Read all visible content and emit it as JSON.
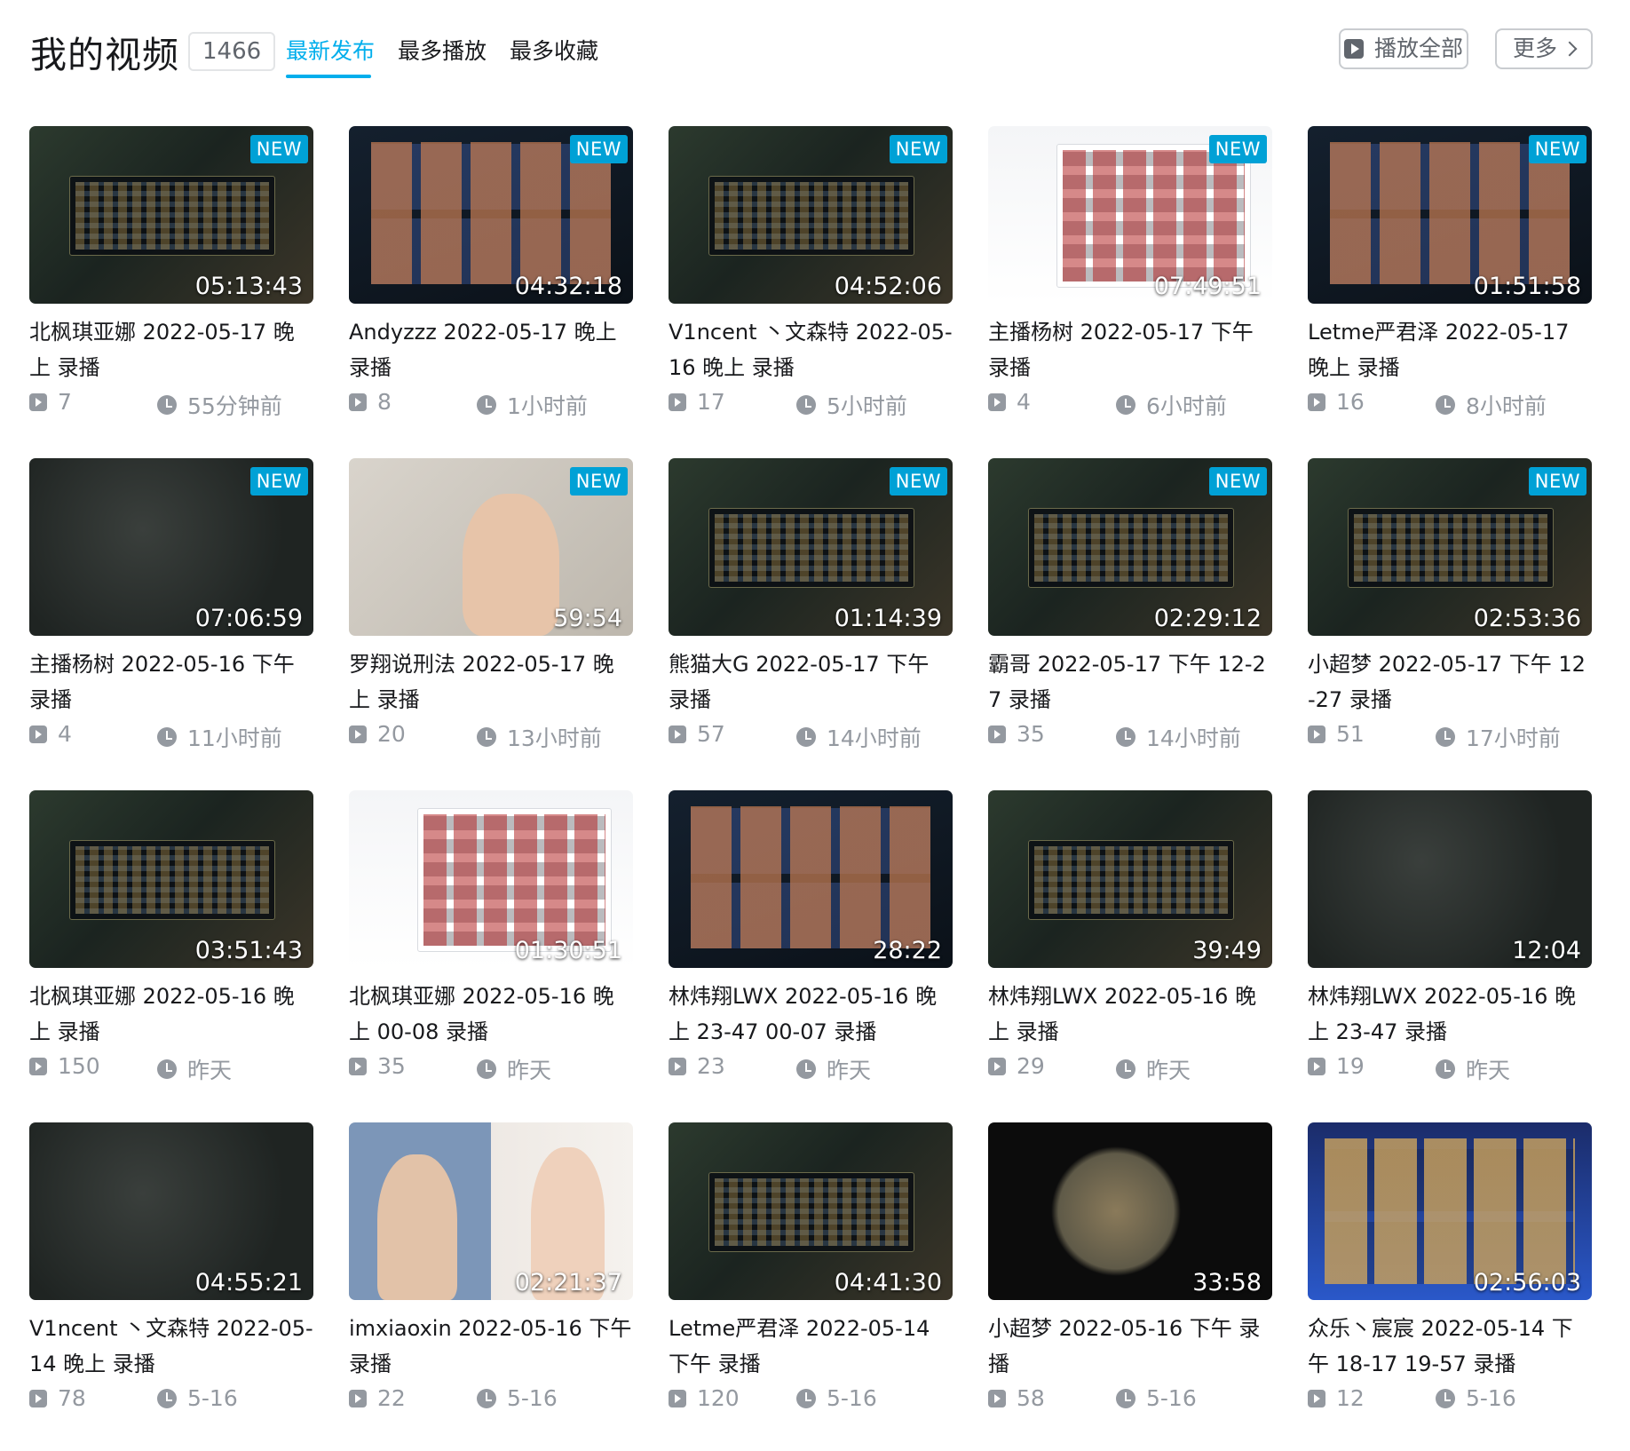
{
  "header": {
    "title": "我的视频",
    "count": "1466",
    "tabs": [
      {
        "label": "最新发布",
        "active": true
      },
      {
        "label": "最多播放",
        "active": false
      },
      {
        "label": "最多收藏",
        "active": false
      }
    ],
    "play_all_label": "播放全部",
    "more_label": "更多"
  },
  "colors": {
    "accent": "#00aeec",
    "new_badge": "#00a1d6",
    "meta_text": "#9499a0"
  },
  "videos": [
    {
      "title": "北枫琪亚娜 2022-05-17 晚上 录播",
      "duration": "05:13:43",
      "plays": "7",
      "time": "55分钟前",
      "new": "NEW",
      "thumb": "game"
    },
    {
      "title": "Andyzzz 2022-05-17 晚上 录播",
      "duration": "04:32:18",
      "plays": "8",
      "time": "1小时前",
      "new": "NEW",
      "thumb": "cards"
    },
    {
      "title": "V1ncent 丶文森特 2022-05-16 晚上 录播",
      "duration": "04:52:06",
      "plays": "17",
      "time": "5小时前",
      "new": "NEW",
      "thumb": "game"
    },
    {
      "title": "主播杨树 2022-05-17 下午 录播",
      "duration": "07:49:51",
      "plays": "4",
      "time": "6小时前",
      "new": "NEW",
      "thumb": "web"
    },
    {
      "title": "Letme严君泽 2022-05-17 晚上 录播",
      "duration": "01:51:58",
      "plays": "16",
      "time": "8小时前",
      "new": "NEW",
      "thumb": "cards"
    },
    {
      "title": "主播杨树 2022-05-16 下午 录播",
      "duration": "07:06:59",
      "plays": "4",
      "time": "11小时前",
      "new": "NEW",
      "thumb": "dark"
    },
    {
      "title": "罗翔说刑法 2022-05-17 晚上 录播",
      "duration": "59:54",
      "plays": "20",
      "time": "13小时前",
      "new": "NEW",
      "thumb": "face"
    },
    {
      "title": "熊猫大G 2022-05-17 下午 录播",
      "duration": "01:14:39",
      "plays": "57",
      "time": "14小时前",
      "new": "NEW",
      "thumb": "game"
    },
    {
      "title": "霸哥 2022-05-17 下午 12-27 录播",
      "duration": "02:29:12",
      "plays": "35",
      "time": "14小时前",
      "new": "NEW",
      "thumb": "game"
    },
    {
      "title": "小超梦 2022-05-17 下午 12-27 录播",
      "duration": "02:53:36",
      "plays": "51",
      "time": "17小时前",
      "new": "NEW",
      "thumb": "game"
    },
    {
      "title": "北枫琪亚娜 2022-05-16 晚上 录播",
      "duration": "03:51:43",
      "plays": "150",
      "time": "昨天",
      "new": "",
      "thumb": "game"
    },
    {
      "title": "北枫琪亚娜 2022-05-16 晚上 00-08 录播",
      "duration": "01:30:51",
      "plays": "35",
      "time": "昨天",
      "new": "",
      "thumb": "web"
    },
    {
      "title": "林炜翔LWX 2022-05-16 晚上 23-47 00-07 录播",
      "duration": "28:22",
      "plays": "23",
      "time": "昨天",
      "new": "",
      "thumb": "cards"
    },
    {
      "title": "林炜翔LWX 2022-05-16 晚上 录播",
      "duration": "39:49",
      "plays": "29",
      "time": "昨天",
      "new": "",
      "thumb": "game"
    },
    {
      "title": "林炜翔LWX 2022-05-16 晚上 23-47 录播",
      "duration": "12:04",
      "plays": "19",
      "time": "昨天",
      "new": "",
      "thumb": "dark"
    },
    {
      "title": "V1ncent 丶文森特 2022-05-14 晚上 录播",
      "duration": "04:55:21",
      "plays": "78",
      "time": "5-16",
      "new": "",
      "thumb": "dark"
    },
    {
      "title": "imxiaoxin 2022-05-16 下午 录播",
      "duration": "02:21:37",
      "plays": "22",
      "time": "5-16",
      "new": "",
      "thumb": "duo"
    },
    {
      "title": "Letme严君泽 2022-05-14 下午 录播",
      "duration": "04:41:30",
      "plays": "120",
      "time": "5-16",
      "new": "",
      "thumb": "game"
    },
    {
      "title": "小超梦 2022-05-16 下午 录播",
      "duration": "33:58",
      "plays": "58",
      "time": "5-16",
      "new": "",
      "thumb": "scope"
    },
    {
      "title": "众乐丶宸宸 2022-05-14 下午 18-17 19-57 录播",
      "duration": "02:56:03",
      "plays": "12",
      "time": "5-16",
      "new": "",
      "thumb": "vs"
    }
  ]
}
